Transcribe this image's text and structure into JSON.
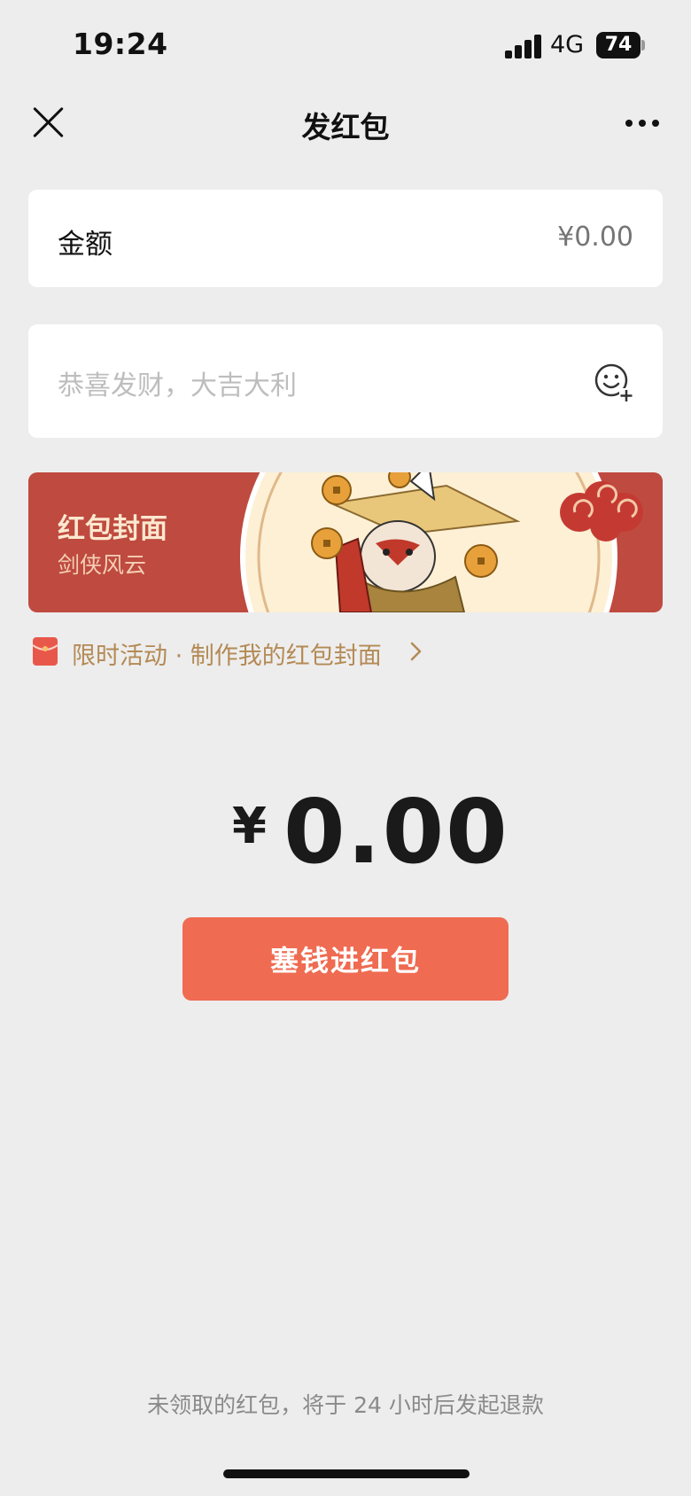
{
  "status_bar": {
    "time": "19:24",
    "network": "4G",
    "battery": "74"
  },
  "nav": {
    "title": "发红包",
    "close_icon": "close-icon",
    "more_icon": "more-icon"
  },
  "amount": {
    "label": "金额",
    "placeholder": "¥0.00"
  },
  "greeting": {
    "placeholder": "恭喜发财，大吉大利",
    "emoji_icon": "emoji-add-icon"
  },
  "cover": {
    "title": "红包封面",
    "subtitle": "剑侠风云"
  },
  "promo": {
    "text": "限时活动 · 制作我的红包封面",
    "icon": "red-packet-icon"
  },
  "total": {
    "currency": "¥",
    "value": "0.00"
  },
  "submit": {
    "label": "塞钱进红包"
  },
  "footer": {
    "note": "未领取的红包，将于 24 小时后发起退款"
  },
  "colors": {
    "accent": "#ef6b51",
    "cover_red": "#bf4a3f",
    "promo_gold": "#b48a55",
    "background": "#ededed"
  }
}
